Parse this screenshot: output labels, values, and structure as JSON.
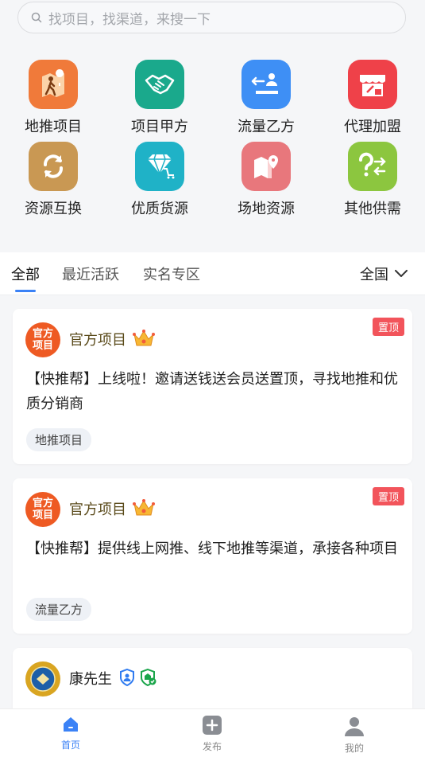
{
  "search": {
    "placeholder": "找项目，找渠道，来搜一下"
  },
  "categories": [
    {
      "label": "地推项目",
      "icon": "map-walker-icon",
      "color": "#f07a3a"
    },
    {
      "label": "项目甲方",
      "icon": "handshake-icon",
      "color": "#1aa98c"
    },
    {
      "label": "流量乙方",
      "icon": "traffic-user-icon",
      "color": "#3e8ff5"
    },
    {
      "label": "代理加盟",
      "icon": "store-lock-icon",
      "color": "#ef4149"
    },
    {
      "label": "资源互换",
      "icon": "exchange-arrows-icon",
      "color": "#c99853"
    },
    {
      "label": "优质货源",
      "icon": "diamond-cart-icon",
      "color": "#1fb2c7"
    },
    {
      "label": "场地资源",
      "icon": "map-location-icon",
      "color": "#e8777c"
    },
    {
      "label": "其他供需",
      "icon": "question-swap-icon",
      "color": "#8cc63f"
    }
  ],
  "tabs": [
    {
      "label": "全部"
    },
    {
      "label": "最近活跃"
    },
    {
      "label": "实名专区"
    }
  ],
  "region": {
    "label": "全国"
  },
  "posts": [
    {
      "avatar_text": "官方\n项目",
      "name": "官方项目",
      "pin_label": "置顶",
      "content": "【快推帮】上线啦！邀请送钱送会员送置顶，寻找地推和优质分销商",
      "tag": "地推项目"
    },
    {
      "avatar_text": "官方\n项目",
      "name": "官方项目",
      "pin_label": "置顶",
      "content": "【快推帮】提供线上网推、线下地推等渠道，承接各种项目",
      "tag": "流量乙方"
    },
    {
      "name": "康先生"
    }
  ],
  "bottom_nav": [
    {
      "label": "首页",
      "icon": "home-icon"
    },
    {
      "label": "发布",
      "icon": "publish-plus-icon"
    },
    {
      "label": "我的",
      "icon": "user-icon"
    }
  ],
  "colors": {
    "accent": "#3b82f6",
    "pin": "#f2545b",
    "official_avatar": "#ee5a23"
  }
}
